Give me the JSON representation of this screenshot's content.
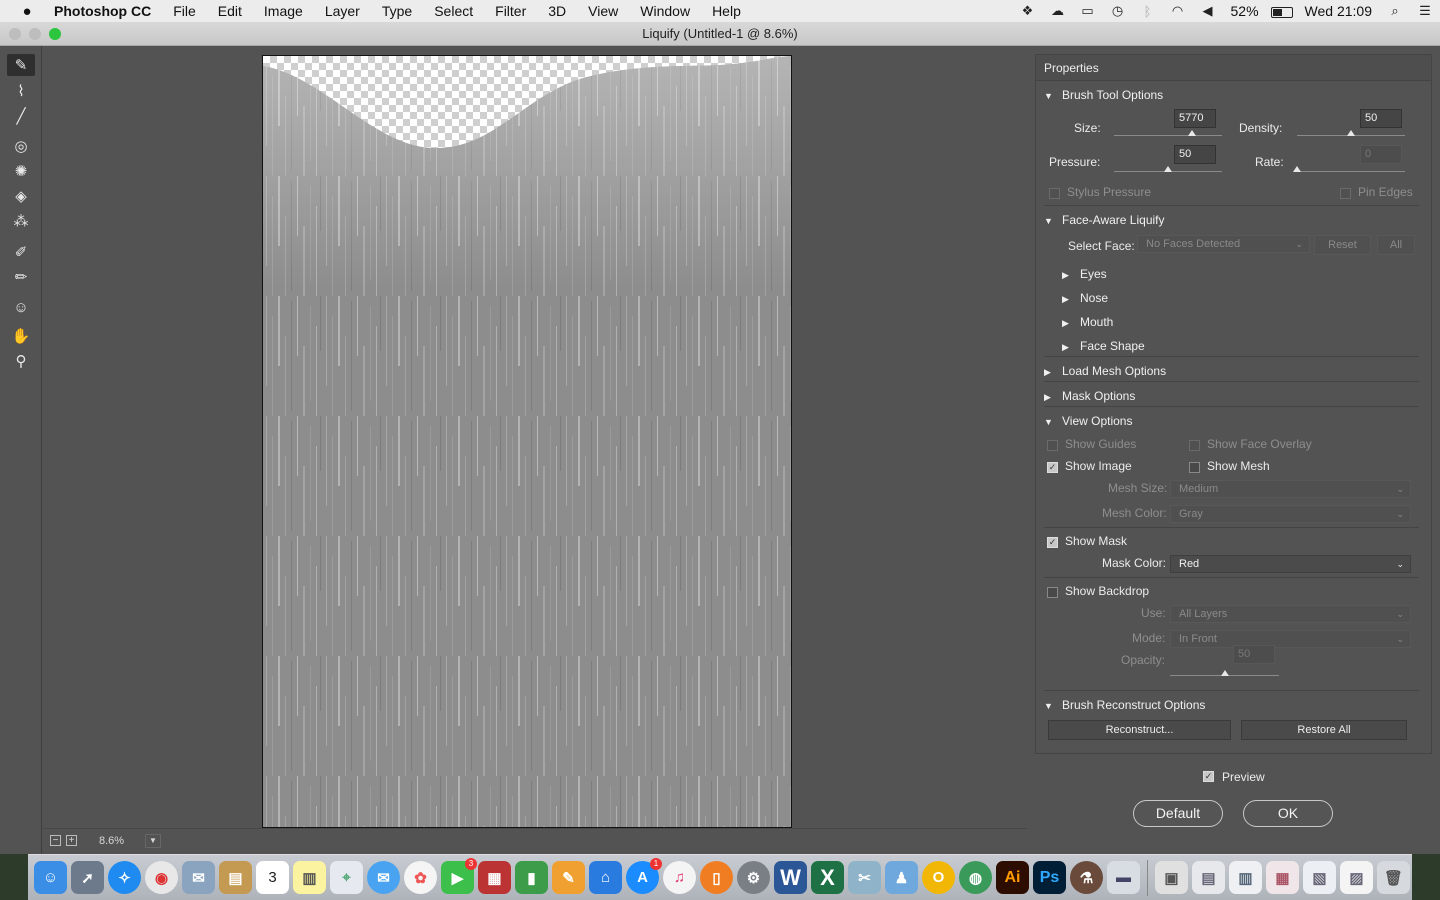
{
  "menubar": {
    "app_name": "Photoshop CC",
    "items": [
      "File",
      "Edit",
      "Image",
      "Layer",
      "Type",
      "Select",
      "Filter",
      "3D",
      "View",
      "Window",
      "Help"
    ],
    "battery": "52%",
    "clock": "Wed 21:09"
  },
  "window": {
    "title": "Liquify (Untitled-1 @ 8.6%)"
  },
  "zoom": {
    "value": "8.6%"
  },
  "panel": {
    "title": "Properties",
    "brush": {
      "header": "Brush Tool Options",
      "size_label": "Size:",
      "size_value": "5770",
      "density_label": "Density:",
      "density_value": "50",
      "pressure_label": "Pressure:",
      "pressure_value": "50",
      "rate_label": "Rate:",
      "rate_value": "0",
      "stylus_label": "Stylus Pressure",
      "pin_edges_label": "Pin Edges",
      "size_level": 0.72,
      "density_level": 0.5,
      "pressure_level": 0.5,
      "rate_level": 0.0
    },
    "face": {
      "header": "Face-Aware Liquify",
      "select_face_label": "Select Face:",
      "select_face_value": "No Faces Detected",
      "reset_label": "Reset",
      "all_label": "All",
      "sub_items": [
        "Eyes",
        "Nose",
        "Mouth",
        "Face Shape"
      ]
    },
    "load_mesh_header": "Load Mesh Options",
    "mask_options_header": "Mask Options",
    "view": {
      "header": "View Options",
      "show_guides": "Show Guides",
      "show_face_overlay": "Show Face Overlay",
      "show_image": "Show Image",
      "show_mesh": "Show Mesh",
      "mesh_size_label": "Mesh Size:",
      "mesh_size_value": "Medium",
      "mesh_color_label": "Mesh Color:",
      "mesh_color_value": "Gray",
      "show_mask": "Show Mask",
      "mask_color_label": "Mask Color:",
      "mask_color_value": "Red",
      "show_backdrop": "Show Backdrop",
      "use_label": "Use:",
      "use_value": "All Layers",
      "mode_label": "Mode:",
      "mode_value": "In Front",
      "opacity_label": "Opacity:",
      "opacity_value": "50",
      "opacity_level": 0.5
    },
    "reconstruct": {
      "header": "Brush Reconstruct Options",
      "reconstruct_label": "Reconstruct...",
      "restore_all_label": "Restore All"
    }
  },
  "preview_label": "Preview",
  "default_label": "Default",
  "ok_label": "OK",
  "dock": {
    "calendar_day": "3",
    "messages_badge": "3",
    "appstore_badge": "1",
    "word_letter": "W",
    "excel_letter": "X",
    "illustrator_letter": "Ai",
    "photoshop_letter": "Ps"
  },
  "colors": {
    "panel_bg": "#535353",
    "workspace_bg": "#535353",
    "accent_ok_border": "#c8c8c8",
    "photoshop_blue": "#31a8ff",
    "illustrator_orange": "#ff9a00"
  }
}
